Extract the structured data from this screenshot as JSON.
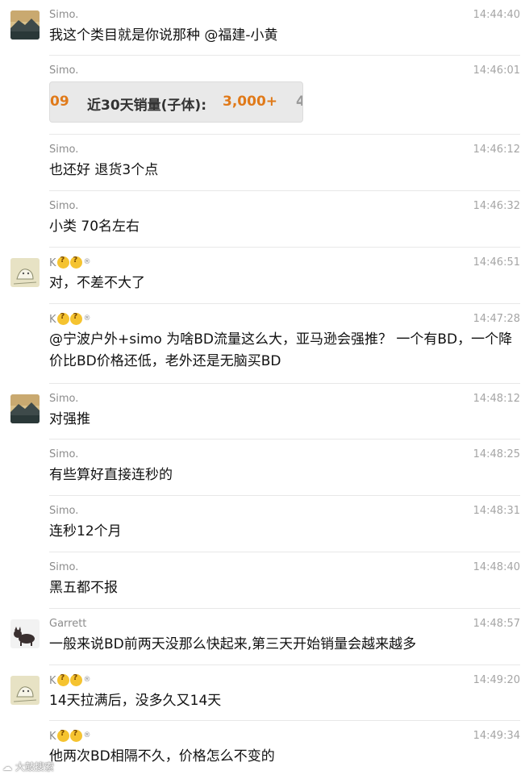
{
  "messages": [
    {
      "sender": "Simo.",
      "time": "14:44:40",
      "text": "我这个类目就是你说那种 @福建-小黄",
      "avatar": "landscape"
    },
    {
      "sender": "Simo.",
      "time": "14:46:01",
      "image": {
        "fragment": "09",
        "label": "近30天销量(子体):",
        "value": "3,000+",
        "tail": "4"
      }
    },
    {
      "sender": "Simo.",
      "time": "14:46:12",
      "text": "也还好 退货3个点"
    },
    {
      "sender": "Simo.",
      "time": "14:46:32",
      "text": "小类 70名左右"
    },
    {
      "sender": "K",
      "time": "14:46:51",
      "text": "对，不差不大了",
      "avatar": "sketch",
      "badge": "®"
    },
    {
      "sender": "K",
      "time": "14:47:28",
      "text": "@宁波户外+simo 为啥BD流量这么大，亚马逊会强推？ 一个有BD，一个降价比BD价格还低，老外还是无脑买BD",
      "badge": "®"
    },
    {
      "sender": "Simo.",
      "time": "14:48:12",
      "text": "对强推",
      "avatar": "landscape"
    },
    {
      "sender": "Simo.",
      "time": "14:48:25",
      "text": "有些算好直接连秒的"
    },
    {
      "sender": "Simo.",
      "time": "14:48:31",
      "text": "连秒12个月"
    },
    {
      "sender": "Simo.",
      "time": "14:48:40",
      "text": "黑五都不报"
    },
    {
      "sender": "Garrett",
      "time": "14:48:57",
      "text": "一般来说BD前两天没那么快起来,第三天开始销量会越来越多",
      "avatar": "cat"
    },
    {
      "sender": "K",
      "time": "14:49:20",
      "text": "14天拉满后，没多久又14天",
      "avatar": "sketch",
      "badge": "®"
    },
    {
      "sender": "K",
      "time": "14:49:34",
      "text": "他两次BD相隔不久，价格怎么不变的",
      "badge": "®"
    }
  ],
  "watermark": "大鼓搜索",
  "colors": {
    "sender": "#8c8c8c",
    "time": "#a5a5a5",
    "divider": "#e8e8e8",
    "accent": "#e07a1a"
  }
}
